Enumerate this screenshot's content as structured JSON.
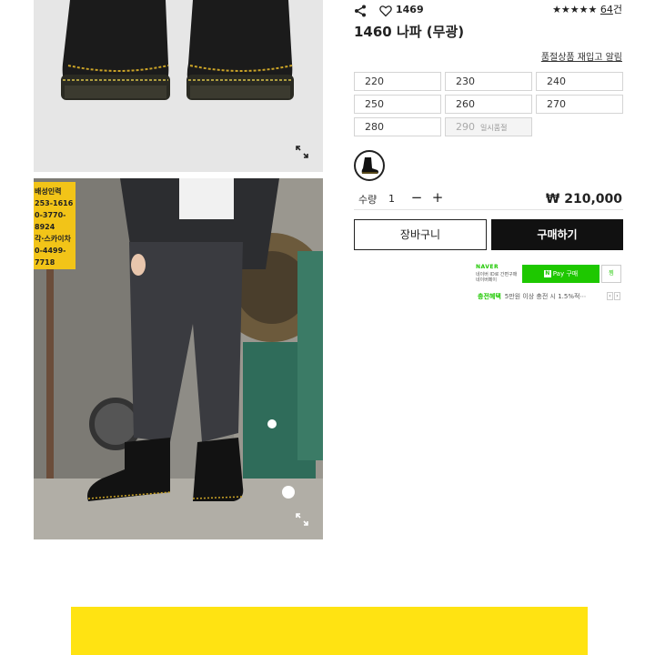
{
  "product": {
    "title": "1460 나파 (무광)",
    "like_count": "1469",
    "rating_stars": "★★★★★",
    "review_count": "64",
    "review_unit": "건",
    "price": "₩ 210,000"
  },
  "icons": {
    "share": "share-icon",
    "like": "heart-icon",
    "zoom": "expand-icon"
  },
  "gallery": {
    "photo2_sign_lines": [
      "배성인력",
      "253-1616",
      "0-3770-8924",
      "각·스카이차",
      "0-4499-7718"
    ]
  },
  "restock": {
    "label": "품절상품 재입고 알림"
  },
  "sizes": [
    {
      "label": "220",
      "soldout": false
    },
    {
      "label": "230",
      "soldout": false
    },
    {
      "label": "240",
      "soldout": false
    },
    {
      "label": "250",
      "soldout": false
    },
    {
      "label": "260",
      "soldout": false
    },
    {
      "label": "270",
      "soldout": false
    },
    {
      "label": "280",
      "soldout": false
    },
    {
      "label": "290",
      "soldout": true,
      "tag": "일시품절"
    }
  ],
  "quantity": {
    "label": "수량",
    "value": "1",
    "minus": "−",
    "plus": "+"
  },
  "actions": {
    "cart": "장바구니",
    "buy": "구매하기"
  },
  "naver_pay": {
    "logo": "NAVER",
    "sub1": "네이버 ID로 간편구매",
    "sub2": "네이버페이",
    "pay_mark": "N",
    "pay_label": "Pay 구매",
    "wish_label": "찜",
    "benefit_tag": "충전혜택",
    "benefit_text": "5만원 이상 충전 시 1.5%적⋯",
    "prev": "‹",
    "next": "›"
  },
  "colors": {
    "accent_yellow": "#ffe312",
    "naver_green": "#1ec800",
    "buy_black": "#111111"
  }
}
